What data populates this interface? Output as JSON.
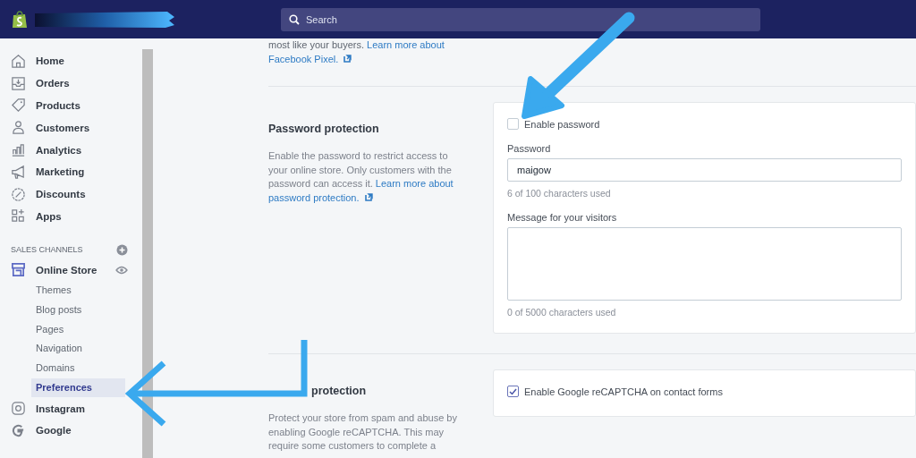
{
  "topbar": {
    "search": {
      "placeholder": "Search"
    }
  },
  "sidebar": {
    "nav": [
      {
        "label": "Home"
      },
      {
        "label": "Orders"
      },
      {
        "label": "Products"
      },
      {
        "label": "Customers"
      },
      {
        "label": "Analytics"
      },
      {
        "label": "Marketing"
      },
      {
        "label": "Discounts"
      },
      {
        "label": "Apps"
      }
    ],
    "sales_channels": {
      "heading": "SALES CHANNELS",
      "channels": [
        {
          "label": "Online Store",
          "children": [
            {
              "label": "Themes",
              "selected": false
            },
            {
              "label": "Blog posts",
              "selected": false
            },
            {
              "label": "Pages",
              "selected": false
            },
            {
              "label": "Navigation",
              "selected": false
            },
            {
              "label": "Domains",
              "selected": false
            },
            {
              "label": "Preferences",
              "selected": true
            }
          ]
        },
        {
          "label": "Instagram"
        },
        {
          "label": "Google"
        }
      ]
    }
  },
  "content": {
    "intro": {
      "text": "most like your buyers. ",
      "link_lines": [
        "Learn more about",
        "Facebook Pixel."
      ]
    },
    "sections": [
      {
        "heading": "Password protection",
        "text": "Enable the password to restrict access to your online store. Only customers with the password can access it. ",
        "link_lines": [
          "Learn more about",
          "password protection."
        ],
        "checkbox": {
          "label": "Enable password",
          "checked": false
        },
        "fields": [
          {
            "kind": "input",
            "label": "Password",
            "value": "maigow",
            "help": "6 of 100 characters used"
          },
          {
            "kind": "textarea",
            "label": "Message for your visitors",
            "help": "0 of 5000 characters used"
          }
        ]
      },
      {
        "heading": "protection",
        "text": "Protect your store from spam and abuse by enabling Google reCAPTCHA. This may require some customers to complete a",
        "checkbox": {
          "label": "Enable Google reCAPTCHA on contact forms",
          "checked": true
        }
      }
    ]
  }
}
